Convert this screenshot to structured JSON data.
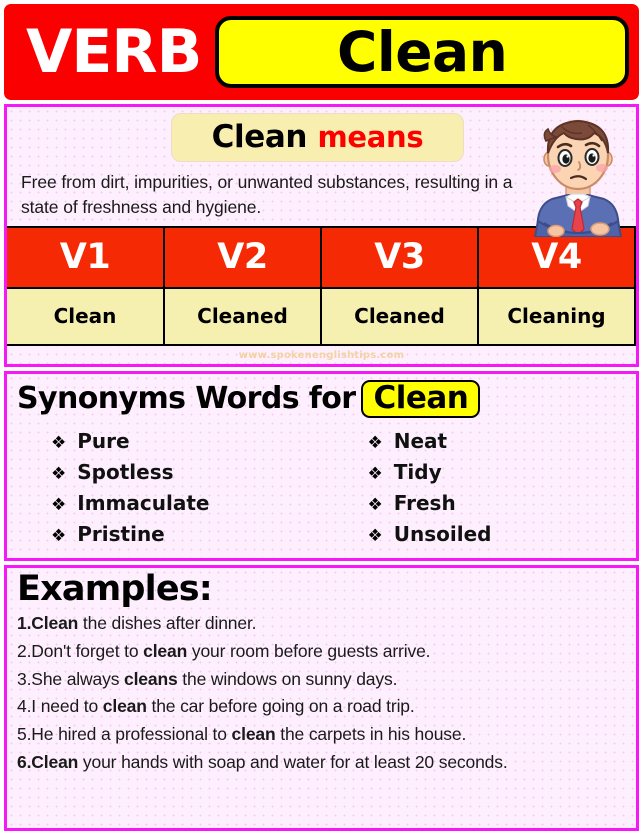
{
  "header": {
    "category_label": "VERB",
    "headword": "Clean"
  },
  "meaning": {
    "title_word": "Clean",
    "title_suffix": "means",
    "definition": "Free from dirt, impurities, or unwanted substances, resulting in a state of freshness and hygiene.",
    "character_icon": "thinking-businessman-icon"
  },
  "verb_table": {
    "headers": [
      "V1",
      "V2",
      "V3",
      "V4"
    ],
    "forms": [
      "Clean",
      "Cleaned",
      "Cleaned",
      "Cleaning"
    ],
    "watermark": "www.spokenenglishtips.com"
  },
  "synonyms": {
    "heading": "Synonyms Words for",
    "chip_word": "Clean",
    "bullet_glyph": "❖",
    "left_column": [
      "Pure",
      "Spotless",
      "Immaculate",
      "Pristine"
    ],
    "right_column": [
      "Neat",
      "Tidy",
      "Fresh",
      "Unsoiled"
    ]
  },
  "examples": {
    "title": "Examples:",
    "items": [
      {
        "number": "1.",
        "bold_lead": "Clean",
        "number_bold": true,
        "rest": " the dishes after dinner.",
        "pre": "",
        "mid_bold": "",
        "post": ""
      },
      {
        "number": "2.",
        "number_bold": false,
        "pre": "Don't forget to ",
        "mid_bold": "clean",
        "post": " your room before guests arrive."
      },
      {
        "number": "3.",
        "number_bold": false,
        "pre": "She always ",
        "mid_bold": "cleans",
        "post": " the windows on sunny days."
      },
      {
        "number": "4.",
        "number_bold": false,
        "pre": "I need to ",
        "mid_bold": "clean",
        "post": " the car before going on a road trip."
      },
      {
        "number": "5.",
        "number_bold": false,
        "pre": "He hired a professional to ",
        "mid_bold": "clean",
        "post": " the carpets in his house."
      },
      {
        "number": "6.",
        "bold_lead": "Clean",
        "number_bold": true,
        "rest": " your hands with soap and water for at least 20 seconds.",
        "pre": "",
        "mid_bold": "",
        "post": ""
      }
    ]
  },
  "colors": {
    "banner_red": "#fb0000",
    "chip_yellow": "#ffff00",
    "panel_border_magenta": "#f618f6",
    "panel_bg_pink": "#fdeffd",
    "table_header_red": "#f52a05",
    "table_cell_yellow": "#f5efb0",
    "means_box_yellow": "#f7eeb0",
    "means_red_text": "#ff0000",
    "watermark_tan": "#f3d2a3"
  }
}
